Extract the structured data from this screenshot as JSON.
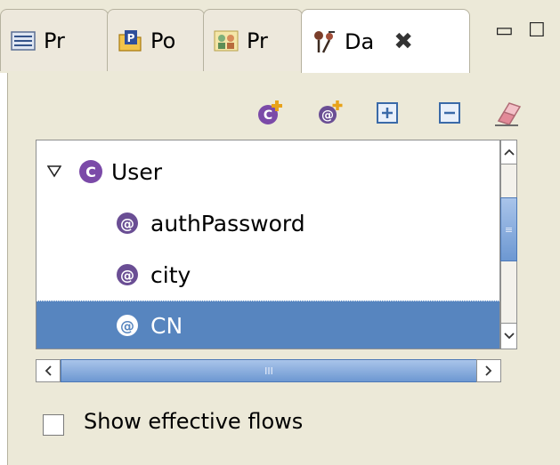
{
  "tabs": [
    {
      "label": "Pr",
      "icon": "outline-list-icon"
    },
    {
      "label": "Po",
      "icon": "policy-p-icon"
    },
    {
      "label": "Pr",
      "icon": "process-people-icon"
    },
    {
      "label": "Da",
      "icon": "data-model-icon",
      "active": true
    }
  ],
  "window_controls": {
    "minimize": "▭",
    "maximize": "☐"
  },
  "close_glyph": "✖",
  "toolbar": [
    {
      "name": "add-class-button",
      "icon": "add-class-icon"
    },
    {
      "name": "add-attribute-button",
      "icon": "add-attribute-icon"
    },
    {
      "name": "expand-all-button",
      "icon": "expand-all-icon"
    },
    {
      "name": "collapse-all-button",
      "icon": "collapse-all-icon"
    },
    {
      "name": "clear-button",
      "icon": "eraser-icon"
    }
  ],
  "tree": {
    "root": {
      "label": "User",
      "badge": "C",
      "expanded": true
    },
    "children": [
      {
        "label": "authPassword",
        "badge": "@"
      },
      {
        "label": "city",
        "badge": "@"
      },
      {
        "label": "CN",
        "badge": "@",
        "selected": true
      }
    ]
  },
  "scroll": {
    "hthumb_glyph": "III",
    "vthumb_glyph": "≡"
  },
  "checkbox": {
    "label": "Show effective flows",
    "checked": false
  },
  "colors": {
    "selection": "#5785bf",
    "class_badge": "#7b4aa8",
    "attribute_badge": "#6a4e94",
    "panel_bg": "#ece9d8"
  }
}
